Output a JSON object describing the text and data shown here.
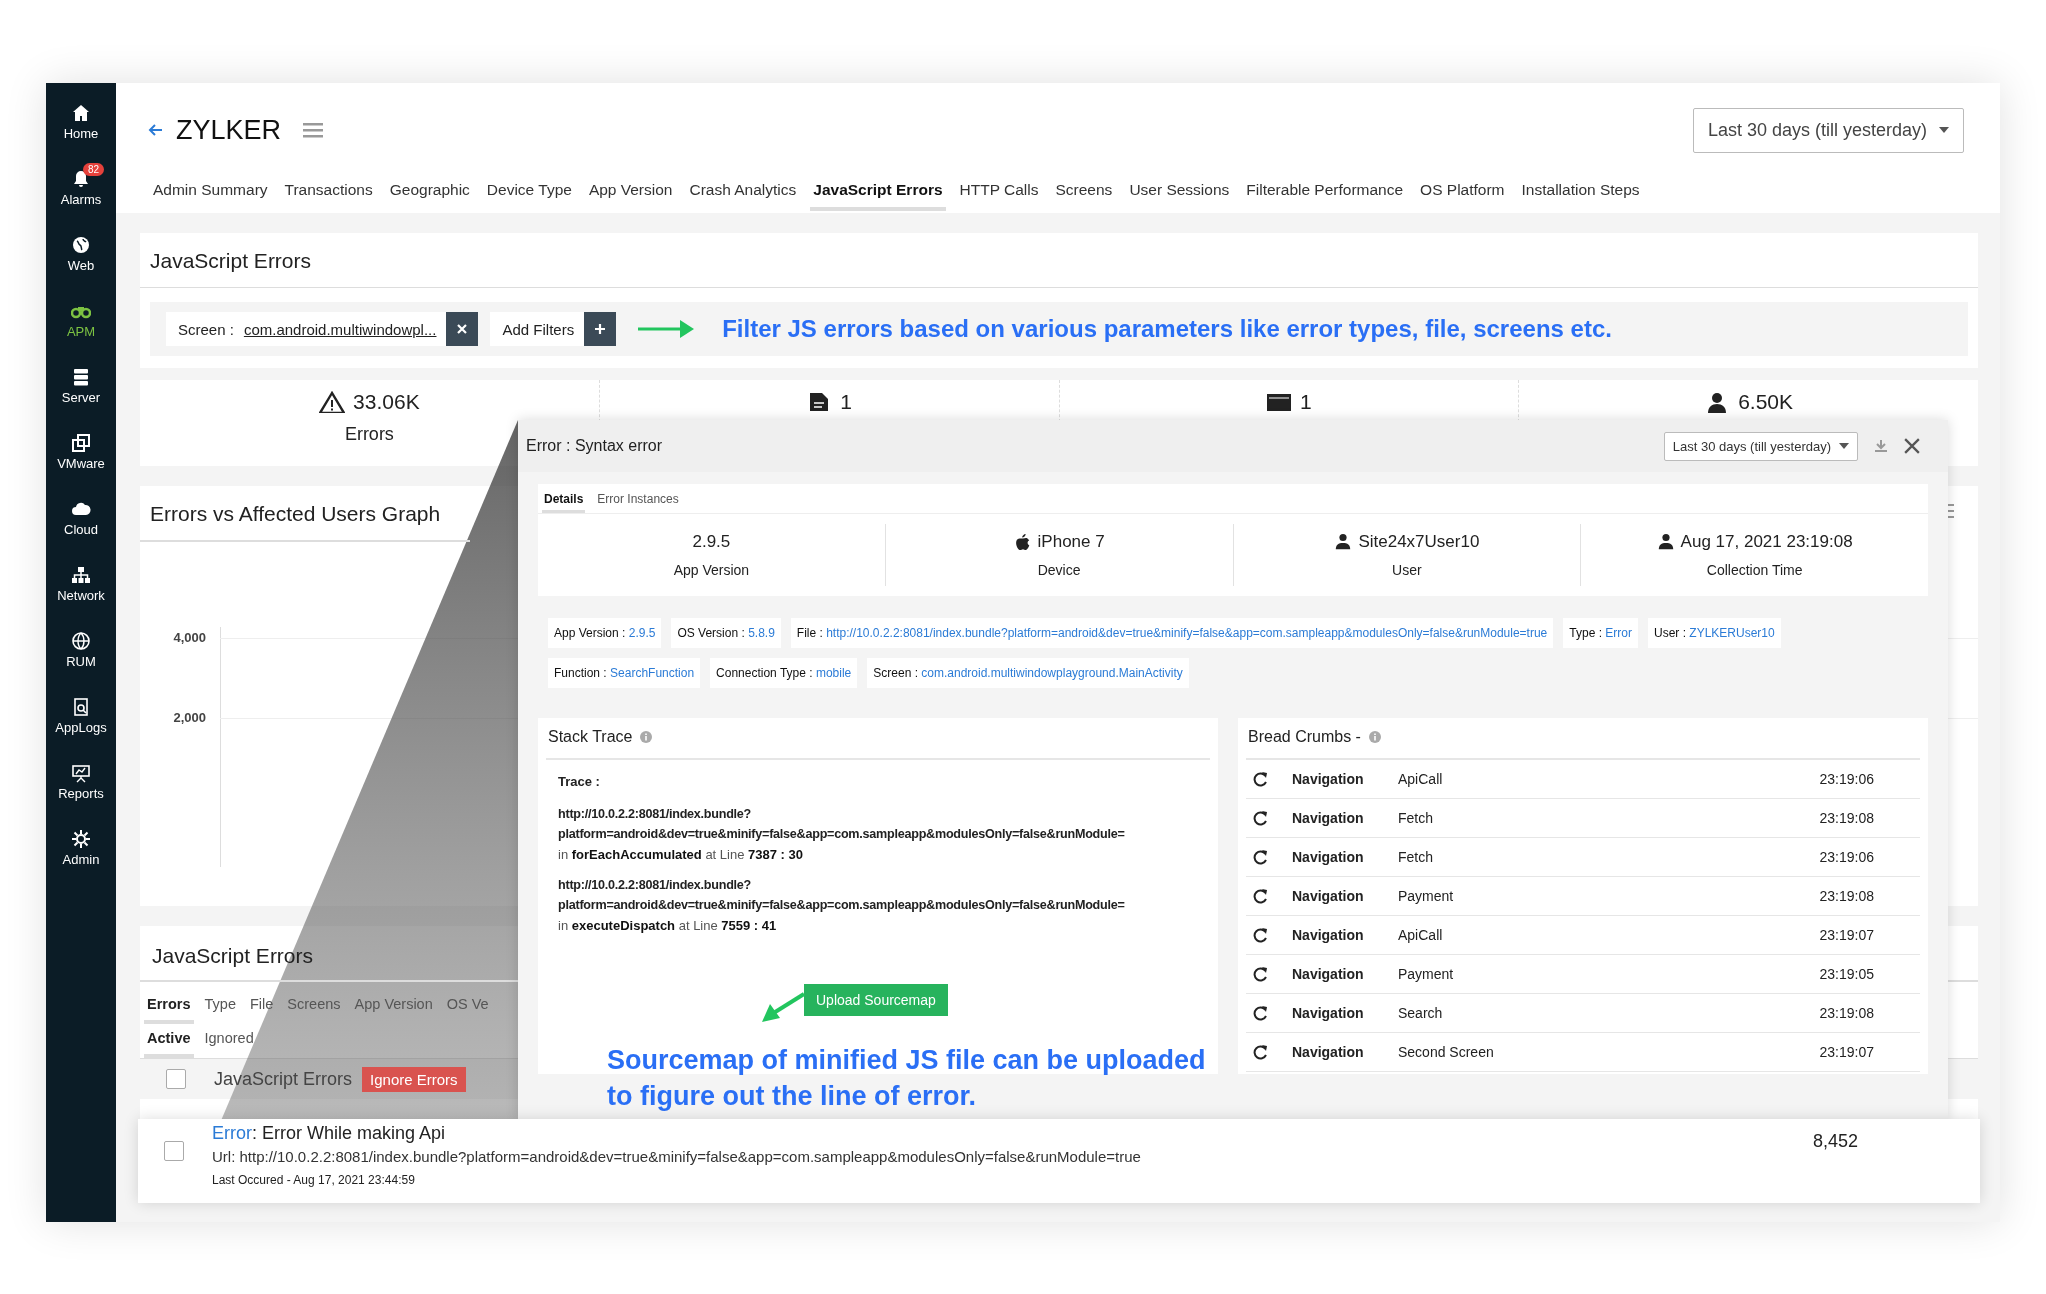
{
  "sidebar": {
    "items": [
      {
        "label": "Home",
        "selected": false
      },
      {
        "label": "Alarms",
        "selected": false,
        "badge": "82"
      },
      {
        "label": "Web",
        "selected": false
      },
      {
        "label": "APM",
        "selected": true
      },
      {
        "label": "Server",
        "selected": false
      },
      {
        "label": "VMware",
        "selected": false
      },
      {
        "label": "Cloud",
        "selected": false
      },
      {
        "label": "Network",
        "selected": false
      },
      {
        "label": "RUM",
        "selected": false
      },
      {
        "label": "AppLogs",
        "selected": false
      },
      {
        "label": "Reports",
        "selected": false
      },
      {
        "label": "Admin",
        "selected": false
      }
    ]
  },
  "header": {
    "title": "ZYLKER",
    "date_range": "Last 30 days (till yesterday)"
  },
  "tabs": [
    {
      "label": "Admin Summary",
      "selected": false
    },
    {
      "label": "Transactions",
      "selected": false
    },
    {
      "label": "Geographic",
      "selected": false
    },
    {
      "label": "Device Type",
      "selected": false
    },
    {
      "label": "App Version",
      "selected": false
    },
    {
      "label": "Crash Analytics",
      "selected": false
    },
    {
      "label": "JavaScript Errors",
      "selected": true
    },
    {
      "label": "HTTP Calls",
      "selected": false
    },
    {
      "label": "Screens",
      "selected": false
    },
    {
      "label": "User Sessions",
      "selected": false
    },
    {
      "label": "Filterable Performance",
      "selected": false
    },
    {
      "label": "OS Platform",
      "selected": false
    },
    {
      "label": "Installation Steps",
      "selected": false
    }
  ],
  "errors_card": {
    "title": "JavaScript Errors",
    "filters": [
      {
        "label": "Screen :",
        "value": "com.android.multiwindowpl..."
      }
    ],
    "add_filters": "Add Filters",
    "annotation": "Filter JS errors based on various parameters like error types, file, screens etc."
  },
  "stats": [
    {
      "value": "33.06K",
      "label": "Errors"
    },
    {
      "value": "1"
    },
    {
      "value": "1"
    },
    {
      "value": "6.50K"
    }
  ],
  "graph": {
    "title": "Errors vs Affected Users Graph",
    "yticks": [
      "4,000",
      "2,000"
    ]
  },
  "errors_list": {
    "title": "JavaScript Errors",
    "tabs": [
      {
        "label": "Errors",
        "selected": true
      },
      {
        "label": "Type",
        "selected": false
      },
      {
        "label": "File",
        "selected": false
      },
      {
        "label": "Screens",
        "selected": false
      },
      {
        "label": "App Version",
        "selected": false
      },
      {
        "label": "OS Ve",
        "selected": false
      }
    ],
    "subtabs": [
      {
        "label": "Active",
        "selected": true
      },
      {
        "label": "Ignored",
        "selected": false
      }
    ],
    "header": {
      "checked": false,
      "label": "JavaScript Errors",
      "action": "Ignore Errors"
    },
    "rows": [
      {
        "checked": false,
        "type": "Error",
        "message": ": Error While making Api",
        "url": "Url: http://10.0.2.2:8081/index.bundle?platform=android&dev=true&minify=false&app=com.sampleapp&modulesOnly=false&runModule=true",
        "last": "Last Occured - Aug 17, 2021 23:44:59",
        "count": "8,452"
      }
    ]
  },
  "detail_panel": {
    "title": "Error : Syntax error",
    "date_range": "Last 30 days (till yesterday)",
    "tabs": [
      {
        "label": "Details",
        "selected": true
      },
      {
        "label": "Error Instances",
        "selected": false
      }
    ],
    "summary": [
      {
        "value": "2.9.5",
        "label": "App Version"
      },
      {
        "value": "iPhone 7",
        "label": "Device"
      },
      {
        "value": "Site24x7User10",
        "label": "User"
      },
      {
        "value": "Aug 17, 2021 23:19:08",
        "label": "Collection Time"
      }
    ],
    "tag_rows": [
      [
        {
          "label": "App Version :",
          "value": "2.9.5"
        },
        {
          "label": "OS Version :",
          "value": "5.8.9"
        },
        {
          "label": "File :",
          "value": "http://10.0.2.2:8081/index.bundle?platform=android&dev=true&minify=false&app=com.sampleapp&modulesOnly=false&runModule=true"
        },
        {
          "label": "Type :",
          "value": "Error"
        },
        {
          "label": "User :",
          "value": "ZYLKERUser10"
        }
      ],
      [
        {
          "label": "Function :",
          "value": "SearchFunction"
        },
        {
          "label": "Connection Type :",
          "value": "mobile"
        },
        {
          "label": "Screen :",
          "value": "com.android.multiwindowplayground.MainActivity"
        }
      ]
    ]
  },
  "stack_trace": {
    "title": "Stack Trace",
    "label": "Trace :",
    "frames": [
      {
        "url": "http://10.0.2.2:8081/index.bundle?",
        "params": "platform=android&dev=true&minify=false&app=com.sampleapp&modulesOnly=false&runModule=",
        "location": "in **forEachAccumulated** at Line **7387 : 30**"
      },
      {
        "url": "http://10.0.2.2:8081/index.bundle?",
        "params": "platform=android&dev=true&minify=false&app=com.sampleapp&modulesOnly=false&runModule=",
        "location": "in **executeDispatch** at Line **7559 : 41**"
      }
    ],
    "button": "Upload Sourcemap",
    "annotation": "Sourcemap of minified JS file can be uploaded to figure out the line of error."
  },
  "breadcrumbs": {
    "title": "Bread Crumbs -",
    "items": [
      {
        "category": "Navigation",
        "action": "ApiCall",
        "time": "23:19:06"
      },
      {
        "category": "Navigation",
        "action": "Fetch",
        "time": "23:19:08"
      },
      {
        "category": "Navigation",
        "action": "Fetch",
        "time": "23:19:06"
      },
      {
        "category": "Navigation",
        "action": "Payment",
        "time": "23:19:08"
      },
      {
        "category": "Navigation",
        "action": "ApiCall",
        "time": "23:19:07"
      },
      {
        "category": "Navigation",
        "action": "Payment",
        "time": "23:19:05"
      },
      {
        "category": "Navigation",
        "action": "Search",
        "time": "23:19:08"
      },
      {
        "category": "Navigation",
        "action": "Second Screen",
        "time": "23:19:07"
      }
    ]
  }
}
